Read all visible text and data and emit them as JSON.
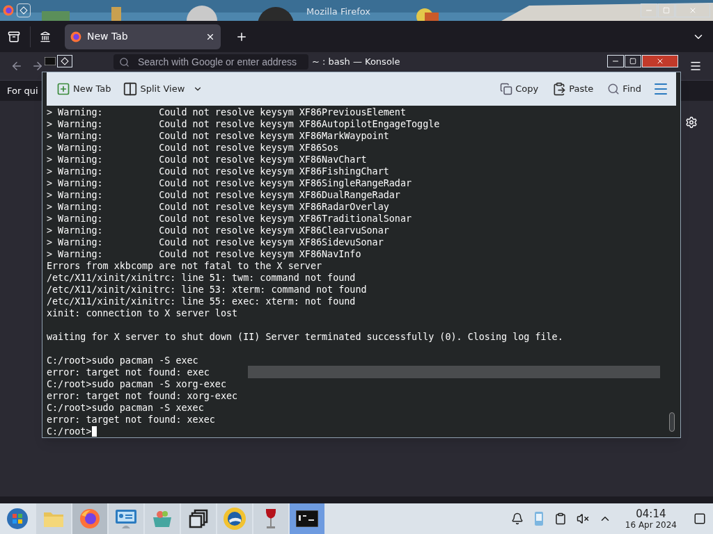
{
  "browser": {
    "title": "Mozilla Firefox",
    "tabs": [
      {
        "label": "New Tab",
        "selected": true
      }
    ],
    "search": {
      "placeholder": "Search with Google or enter address"
    },
    "bookmarks_hint": "For qui"
  },
  "konsole": {
    "title": "~ : bash — Konsole",
    "toolbar": [
      {
        "kind": "new-tab",
        "label": "New Tab"
      },
      {
        "kind": "split",
        "label": "Split View"
      },
      {
        "kind": "copy",
        "label": "Copy"
      },
      {
        "kind": "paste",
        "label": "Paste"
      },
      {
        "kind": "find",
        "label": "Find"
      }
    ],
    "blocks": [
      [
        "> Warning:          Could not resolve keysym XF86PreviousElement",
        "> Warning:          Could not resolve keysym XF86AutopilotEngageToggle",
        "> Warning:          Could not resolve keysym XF86MarkWaypoint",
        "> Warning:          Could not resolve keysym XF86Sos",
        "> Warning:          Could not resolve keysym XF86NavChart",
        "> Warning:          Could not resolve keysym XF86FishingChart",
        "> Warning:          Could not resolve keysym XF86SingleRangeRadar",
        "> Warning:          Could not resolve keysym XF86DualRangeRadar",
        "> Warning:          Could not resolve keysym XF86RadarOverlay",
        "> Warning:          Could not resolve keysym XF86TraditionalSonar",
        "> Warning:          Could not resolve keysym XF86ClearvuSonar",
        "> Warning:          Could not resolve keysym XF86SidevuSonar",
        "> Warning:          Could not resolve keysym XF86NavInfo",
        "Errors from xkbcomp are not fatal to the X server",
        "/etc/X11/xinit/xinitrc: line 51: twm: command not found",
        "/etc/X11/xinit/xinitrc: line 53: xterm: command not found",
        "/etc/X11/xinit/xinitrc: line 55: exec: xterm: not found",
        "xinit: connection to X server lost"
      ],
      [
        "waiting for X server to shut down (II) Server terminated successfully (0). Closing log file."
      ],
      [
        "C:/root>sudo pacman -S exec",
        "error: target not found: exec",
        "C:/root>sudo pacman -S xorg-exec",
        "error: target not found: xorg-exec",
        "C:/root>sudo pacman -S xexec",
        "error: target not found: xexec"
      ]
    ],
    "prompt": "C:/root>"
  },
  "taskbar": {
    "tasks": [
      {
        "kind": "files",
        "selected": false
      },
      {
        "kind": "firefox",
        "selected": true
      },
      {
        "kind": "settings",
        "selected": false
      },
      {
        "kind": "store",
        "selected": false
      },
      {
        "kind": "windows",
        "selected": false
      },
      {
        "kind": "globe",
        "selected": false
      },
      {
        "kind": "wine",
        "selected": false
      },
      {
        "kind": "terminal",
        "selected": true
      }
    ],
    "tray": [
      {
        "kind": "bell"
      },
      {
        "kind": "device"
      },
      {
        "kind": "clipboard"
      },
      {
        "kind": "muted"
      },
      {
        "kind": "expand"
      }
    ],
    "time": "04:14",
    "date": "16 Apr 2024"
  }
}
